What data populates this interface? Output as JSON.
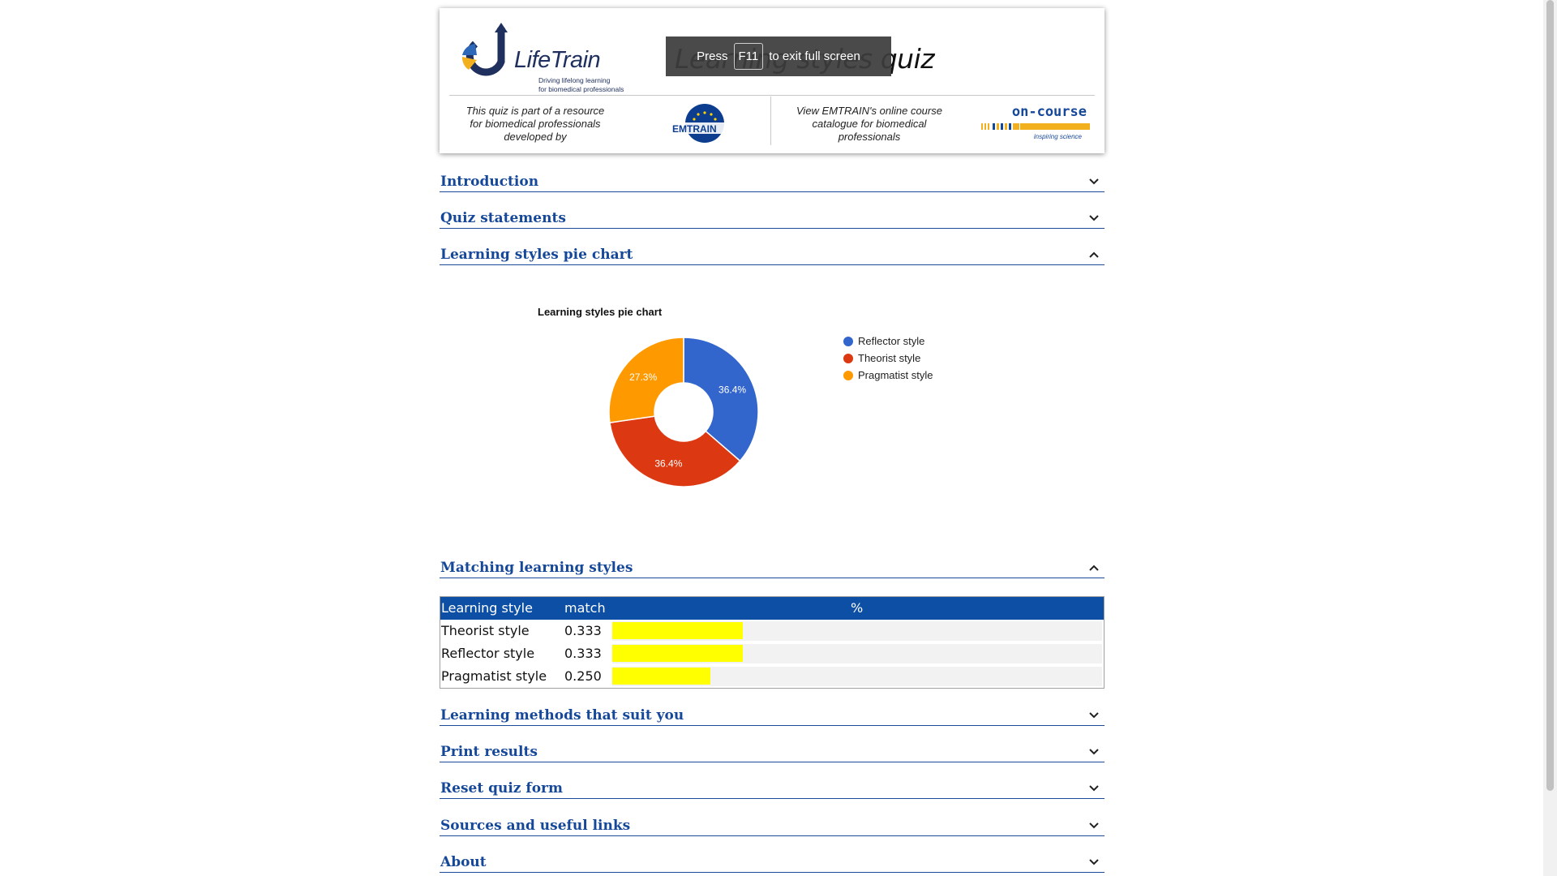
{
  "header": {
    "logo_word": "LifeTrain",
    "logo_tagline_1": "Driving lifelong learning",
    "logo_tagline_2": "for biomedical professionals",
    "page_title": "Learning styles quiz",
    "fullscreen_notice": {
      "press": "Press",
      "key": "F11",
      "rest": "to exit full screen"
    },
    "note_left": "This quiz is part of a resource for biomedical professionals developed by",
    "emtrain_label": "EMTRAIN",
    "note_right": "View EMTRAIN's online course catalogue for biomedical professionals",
    "oncourse_label": "on-course",
    "oncourse_tagline": "inspiring science"
  },
  "sections": {
    "introduction": "Introduction",
    "quiz_statements": "Quiz statements",
    "pie_chart": "Learning styles pie chart",
    "matching": "Matching learning styles",
    "methods": "Learning methods that suit you",
    "print": "Print results",
    "reset": "Reset quiz form",
    "sources": "Sources and useful links",
    "about": "About"
  },
  "chart_data": {
    "type": "pie",
    "title": "Learning styles pie chart",
    "donut": true,
    "categories": [
      "Reflector style",
      "Theorist style",
      "Pragmatist style"
    ],
    "values": [
      36.4,
      36.4,
      27.3
    ],
    "labels": [
      "36.4%",
      "36.4%",
      "27.3%"
    ],
    "colors": [
      "#3366cc",
      "#dc3912",
      "#ff9900"
    ],
    "legend_position": "right"
  },
  "match_table": {
    "headers": [
      "Learning style",
      "match",
      "%"
    ],
    "rows": [
      {
        "style": "Theorist style",
        "match": "0.333",
        "fraction": 0.333
      },
      {
        "style": "Reflector style",
        "match": "0.333",
        "fraction": 0.333
      },
      {
        "style": "Pragmatist style",
        "match": "0.250",
        "fraction": 0.25
      }
    ],
    "bar_color": "#ffff00"
  }
}
